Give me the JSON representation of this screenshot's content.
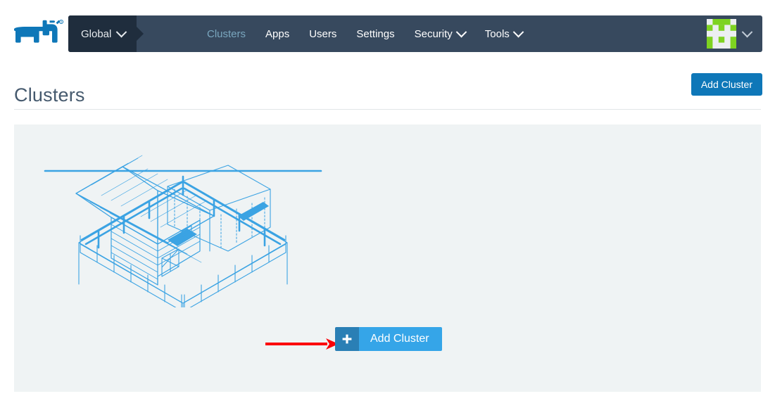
{
  "app": {
    "logo_icon": "rancher-bull-logo",
    "logo_trademark": "®"
  },
  "navbar": {
    "context": {
      "label": "Global",
      "chevron_icon": "chevron-down-icon"
    },
    "items": [
      {
        "label": "Clusters",
        "active": true,
        "has_menu": false
      },
      {
        "label": "Apps",
        "active": false,
        "has_menu": false
      },
      {
        "label": "Users",
        "active": false,
        "has_menu": false
      },
      {
        "label": "Settings",
        "active": false,
        "has_menu": false
      },
      {
        "label": "Security",
        "active": false,
        "has_menu": true
      },
      {
        "label": "Tools",
        "active": false,
        "has_menu": true
      }
    ],
    "user_menu": {
      "avatar_icon": "identicon-avatar",
      "chevron_icon": "chevron-down-icon"
    },
    "colors": {
      "bar_background": "#37495e",
      "context_background": "#1f2d3d",
      "active_text": "#7aa7bf",
      "text": "#ffffff"
    }
  },
  "header": {
    "title": "Clusters",
    "add_cluster_label": "Add Cluster"
  },
  "panel": {
    "illustration_name": "isometric-farm-barn-illustration",
    "cta": {
      "plus_icon": "plus-icon",
      "label": "Add Cluster"
    },
    "annotation": {
      "name": "red-arrow-annotation",
      "color": "#fb0007",
      "direction": "right"
    }
  },
  "colors": {
    "primary_blue": "#0e77b8",
    "cta_blue": "#35a5e8",
    "cta_plus_blue": "#2a7fb5",
    "panel_background": "#eff3f4",
    "illustration_stroke": "#3ba3e3",
    "title_text": "#465a6e"
  }
}
